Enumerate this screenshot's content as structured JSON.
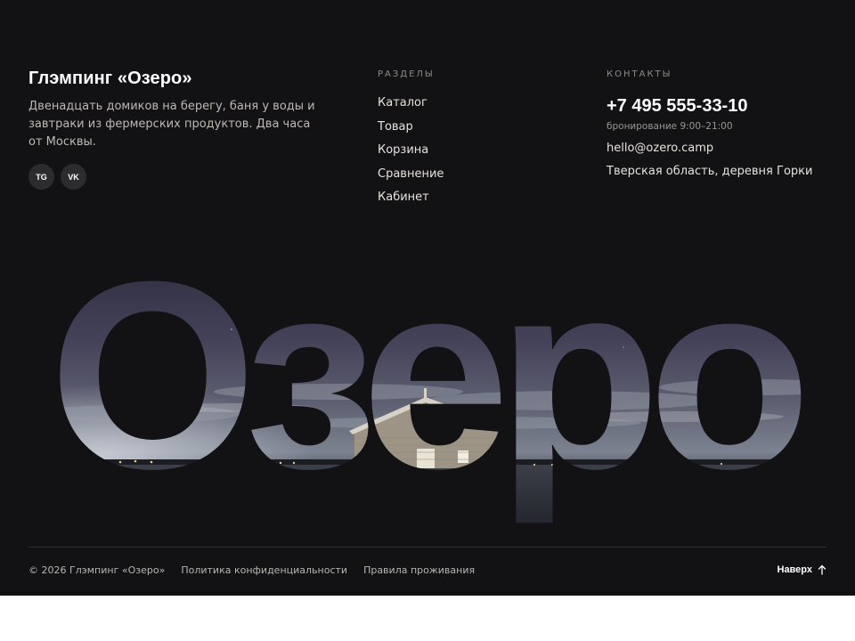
{
  "brand": {
    "title": "Глэмпинг «Озеро»",
    "description": "Двенадцать домиков на берегу, баня у воды и завтраки из фермерских продуктов. Два часа от Москвы.",
    "socials": [
      {
        "label": "TG",
        "icon": "telegram-icon"
      },
      {
        "label": "VK",
        "icon": "vk-icon"
      }
    ]
  },
  "nav": {
    "heading": "РАЗДЕЛЫ",
    "items": [
      "Каталог",
      "Товар",
      "Корзина",
      "Сравнение",
      "Кабинет"
    ]
  },
  "contacts": {
    "heading": "КОНТАКТЫ",
    "phone": "+7 495 555-33-10",
    "hours": "бронирование 9:00–21:00",
    "email": "hello@ozero.camp",
    "address": "Тверская область, деревня Горки"
  },
  "hero": {
    "word": "Озеро",
    "image": "night lake with wooden house under cloudy sky"
  },
  "bottom": {
    "copyright": "© 2026 Глэмпинг «Озеро»",
    "privacy": "Политика конфиденциальности",
    "rules": "Правила проживания",
    "to_top": "Наверх",
    "to_top_icon": "arrow-up-icon"
  },
  "colors": {
    "background": "#121113",
    "text_primary": "#ffffff",
    "text_muted": "#8e8b87",
    "social_bg": "#2c2b2e"
  }
}
